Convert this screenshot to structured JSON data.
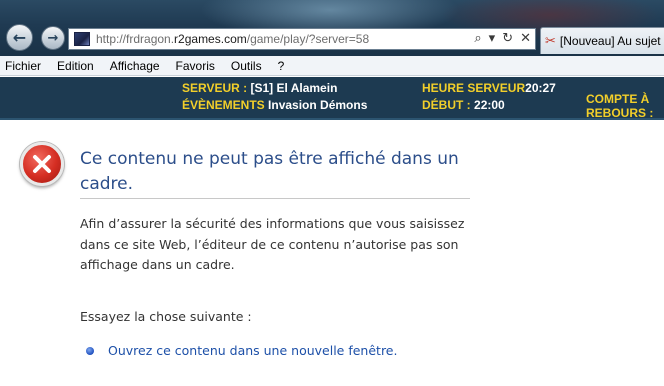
{
  "browser": {
    "url_prefix": "http://frdragon.",
    "url_host": "r2games.com",
    "url_path": "/game/play/?server=58",
    "back_glyph": "←",
    "forward_glyph": "→",
    "search_glyph": "⌕",
    "dropdown_glyph": "▾",
    "refresh_glyph": "↻",
    "close_glyph": "✕",
    "tab_label": "[Nouveau] Au sujet"
  },
  "menu": [
    "Fichier",
    "Edition",
    "Affichage",
    "Favoris",
    "Outils",
    "?"
  ],
  "banner": {
    "server_label": "SERVEUR :",
    "server_value": "[S1] El Alamein",
    "events_label": "ÉVÈNEMENTS",
    "events_value": "Invasion Démons",
    "time_label": "HEURE SERVEUR",
    "time_value": "20:27",
    "start_label": "DÉBUT :",
    "start_value": "22:00",
    "countdown_line1": "COMPTE À",
    "countdown_line2": "REBOURS :"
  },
  "error": {
    "title": "Ce contenu ne peut pas être affiché dans un cadre.",
    "body": "Afin d’assurer la sécurité des informations que vous saisissez dans ce site Web, l’éditeur de ce contenu n’autorise pas son affichage dans un cadre.",
    "suggestion": "Essayez la chose suivante :",
    "link": "Ouvrez ce contenu dans une nouvelle fenêtre."
  }
}
